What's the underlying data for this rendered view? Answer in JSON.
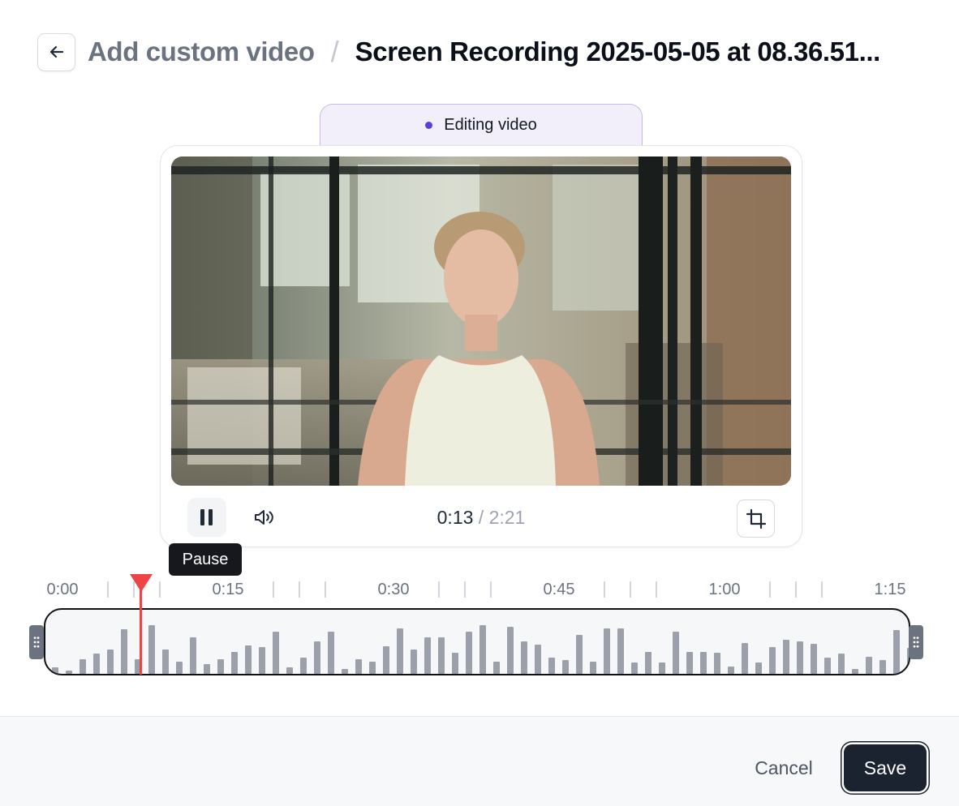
{
  "header": {
    "back_icon": "arrow-left-icon",
    "parent_label": "Add custom video",
    "separator": "/",
    "title": "Screen Recording 2025-05-05 at 08.36.51..."
  },
  "editor": {
    "status_label": "Editing video",
    "status_color": "#5b3fd8"
  },
  "player": {
    "current_time": "0:13",
    "time_separator": " / ",
    "duration": "2:21",
    "pause_icon": "pause-icon",
    "volume_icon": "volume-icon",
    "crop_icon": "crop-icon",
    "tooltip": "Pause"
  },
  "timeline": {
    "labels": [
      "0:00",
      "0:15",
      "0:30",
      "0:45",
      "1:00",
      "1:15"
    ],
    "playhead_seconds": 13,
    "playhead_color": "#ef4444"
  },
  "footer": {
    "cancel_label": "Cancel",
    "save_label": "Save"
  }
}
